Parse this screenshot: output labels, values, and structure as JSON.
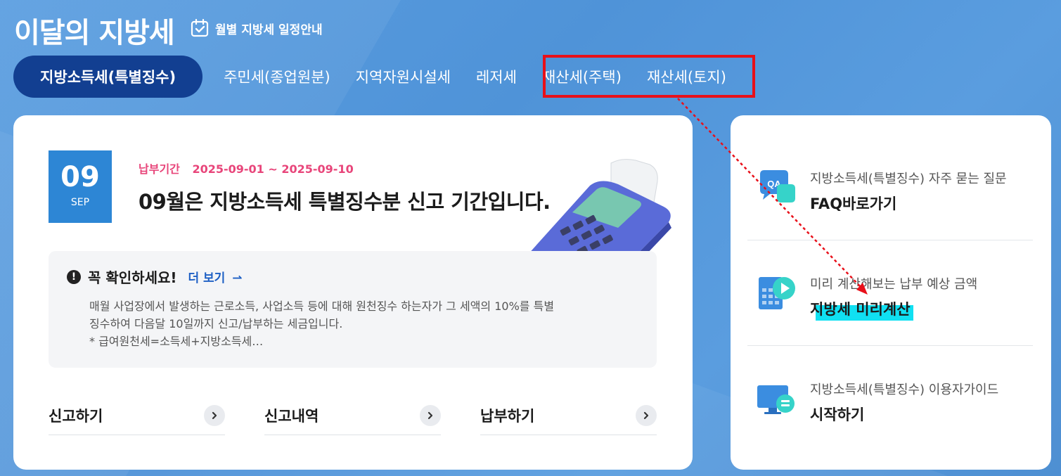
{
  "header": {
    "title": "이달의 지방세",
    "schedule_label": "월별 지방세 일정안내"
  },
  "tabs": [
    {
      "label": "지방소득세(특별징수)",
      "active": true
    },
    {
      "label": "주민세(종업원분)",
      "active": false
    },
    {
      "label": "지역자원시설세",
      "active": false
    },
    {
      "label": "레저세",
      "active": false
    },
    {
      "label": "재산세(주택)",
      "active": false
    },
    {
      "label": "재산세(토지)",
      "active": false
    }
  ],
  "main": {
    "date_day": "09",
    "date_month": "SEP",
    "period_label": "납부기간",
    "period_value": "2025-09-01 ~ 2025-09-10",
    "headline": "09월은 지방소득세 특별징수분 신고 기간입니다.",
    "notice": {
      "icon": "!",
      "title": "꼭 확인하세요!",
      "more_label": "더 보기",
      "line1": "매월 사업장에서 발생하는 근로소득, 사업소득 등에 대해 원천징수 하는자가 그 세액의 10%를 특별",
      "line2": "징수하여 다음달 10일까지 신고/납부하는 세금입니다.",
      "line3": "* 급여원천세=소득세+지방소득세…"
    },
    "actions": [
      {
        "label": "신고하기"
      },
      {
        "label": "신고내역"
      },
      {
        "label": "납부하기"
      }
    ]
  },
  "side": {
    "items": [
      {
        "sub": "지방소득세(특별징수) 자주 묻는 질문",
        "main": "FAQ바로가기",
        "icon": "qa-icon"
      },
      {
        "sub": "미리 계산해보는 납부 예상 금액",
        "main": "지방세 미리계산",
        "icon": "calculator-icon"
      },
      {
        "sub": "지방소득세(특별징수) 이용자가이드",
        "main": "시작하기",
        "icon": "monitor-guide-icon"
      }
    ]
  },
  "colors": {
    "background": "#5299da",
    "active_tab": "#123f91",
    "date_box": "#2d86d5",
    "period": "#e8457a",
    "link": "#1d5fc4",
    "annotation_red": "#e8101a",
    "highlight_cyan": "#10e0f2"
  }
}
